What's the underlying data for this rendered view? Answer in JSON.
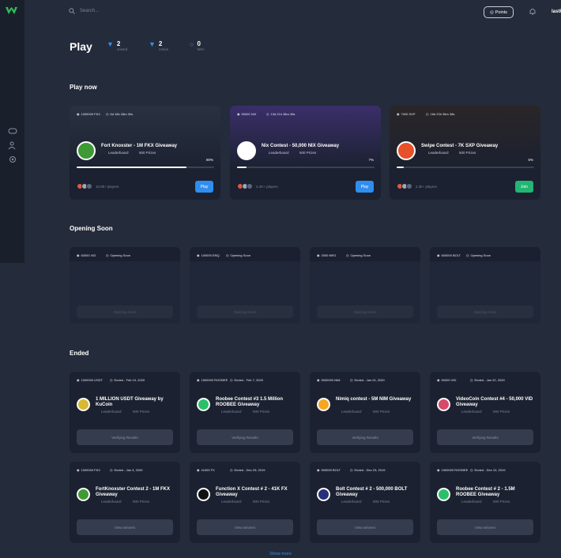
{
  "header": {
    "search_placeholder": "Search...",
    "points_label": "Points",
    "username": "lasthashbeater"
  },
  "play": {
    "title": "Play",
    "stats": [
      {
        "num": "2",
        "label": "Joined"
      },
      {
        "num": "2",
        "label": "Active"
      },
      {
        "num": "0",
        "label": "Won"
      }
    ]
  },
  "sections": {
    "play_now": "Play now",
    "opening_soon": "Opening Soon",
    "ended": "Ended"
  },
  "play_now": [
    {
      "prize": "1000000 FKX",
      "time": "6d 18h 28m 30s",
      "title": "Fort Knoxster - 1M FKX Giveaway",
      "leaderboard": "Leaderboard",
      "prizes": "500 Prizes",
      "progress": "80%",
      "progress_value": 0.8,
      "players": "10.8k+ players",
      "button": "Play",
      "icon_color": "#3d9a35",
      "bg": "#2a3242",
      "btn_color": "#2f8ef0"
    },
    {
      "prize": "50000 NIX",
      "time": "13d 21h 38m 38s",
      "title": "Nix Contest - 50,000 NIX Giveaway",
      "leaderboard": "Leaderboard",
      "prizes": "500 Prizes",
      "progress": "7%",
      "progress_value": 0.07,
      "players": "2.4K+ players",
      "button": "Play",
      "icon_color": "#ffffff",
      "bg": "#3a2f6a",
      "btn_color": "#2f8ef0"
    },
    {
      "prize": "7000 SXP",
      "time": "18d 23h 36m 38s",
      "title": "Swipe Contest - 7K SXP Giveaway",
      "leaderboard": "Leaderboard",
      "prizes": "500 Prizes",
      "progress": "5%",
      "progress_value": 0.05,
      "players": "2.3k+ players",
      "button": "Join",
      "icon_color": "#e8502a",
      "bg": "#2a2628",
      "btn_color": "#22b573"
    }
  ],
  "opening_soon": [
    {
      "prize": "60000 VID",
      "status": "Opening Soon",
      "button": "Opening Soon"
    },
    {
      "prize": "100000 ENQ",
      "status": "Opening Soon",
      "button": "Opening Soon"
    },
    {
      "prize": "2000 NRG",
      "status": "Opening Soon",
      "button": "Opening Soon"
    },
    {
      "prize": "600000 BOLT",
      "status": "Opening Soon",
      "button": "Opening Soon"
    }
  ],
  "ended": [
    {
      "prize": "1000000 USDT",
      "time": "Ended - Feb 10, 2020",
      "title": "1 MILLION USDT Giveaway by KuCoin",
      "leaderboard": "Leaderboard",
      "prizes": "500 Prizes",
      "button": "Verifying Results",
      "icon_color": "#d9b832"
    },
    {
      "prize": "1500000 ROOBEE",
      "time": "Ended - Feb 7, 2020",
      "title": "Roobee Contest #3 1.5 Million ROOBEE Giveaway",
      "leaderboard": "Leaderboard",
      "prizes": "500 Prizes",
      "button": "Verifying Results",
      "icon_color": "#2bbf6a"
    },
    {
      "prize": "5000000 NIM",
      "time": "Ended - Jan 24, 2020",
      "title": "Nimiq contest - 5M NIM Giveaway",
      "leaderboard": "Leaderboard",
      "prizes": "500 Prizes",
      "button": "Verifying Results",
      "icon_color": "#f5a623"
    },
    {
      "prize": "50000 VID",
      "time": "Ended - Jan 22, 2020",
      "title": "VideoCoin Contest #4 - 50,000 VID Giveaway",
      "leaderboard": "Leaderboard",
      "prizes": "500 Prizes",
      "button": "Verifying Results",
      "icon_color": "#d8486a"
    },
    {
      "prize": "1000000 FKX",
      "time": "Ended - Jan 3, 2020",
      "title": "FortKnoxster Contest 2 - 1M FKX Giveaway",
      "leaderboard": "Leaderboard",
      "prizes": "500 Prizes",
      "button": "View winners",
      "icon_color": "#3d9a35"
    },
    {
      "prize": "41000 FX",
      "time": "Ended - Dec 29, 2019",
      "title": "Function X Contest # 2 - 41K FX Giveaway",
      "leaderboard": "Leaderboard",
      "prizes": "500 Prizes",
      "button": "View winners",
      "icon_color": "#111111"
    },
    {
      "prize": "500000 BOLT",
      "time": "Ended - Dec 23, 2019",
      "title": "Bolt Contest # 2 - 500,000 BOLT Giveaway",
      "leaderboard": "Leaderboard",
      "prizes": "500 Prizes",
      "button": "View winners",
      "icon_color": "#2a2f7a"
    },
    {
      "prize": "1500000 ROOBEE",
      "time": "Ended - Dec 12, 2019",
      "title": "Roobee Contest # 2 - 1.5M ROOBEE Giveaway",
      "leaderboard": "Leaderboard",
      "prizes": "500 Prizes",
      "button": "View winners",
      "icon_color": "#2bbf6a"
    }
  ],
  "show_more": "Show more"
}
